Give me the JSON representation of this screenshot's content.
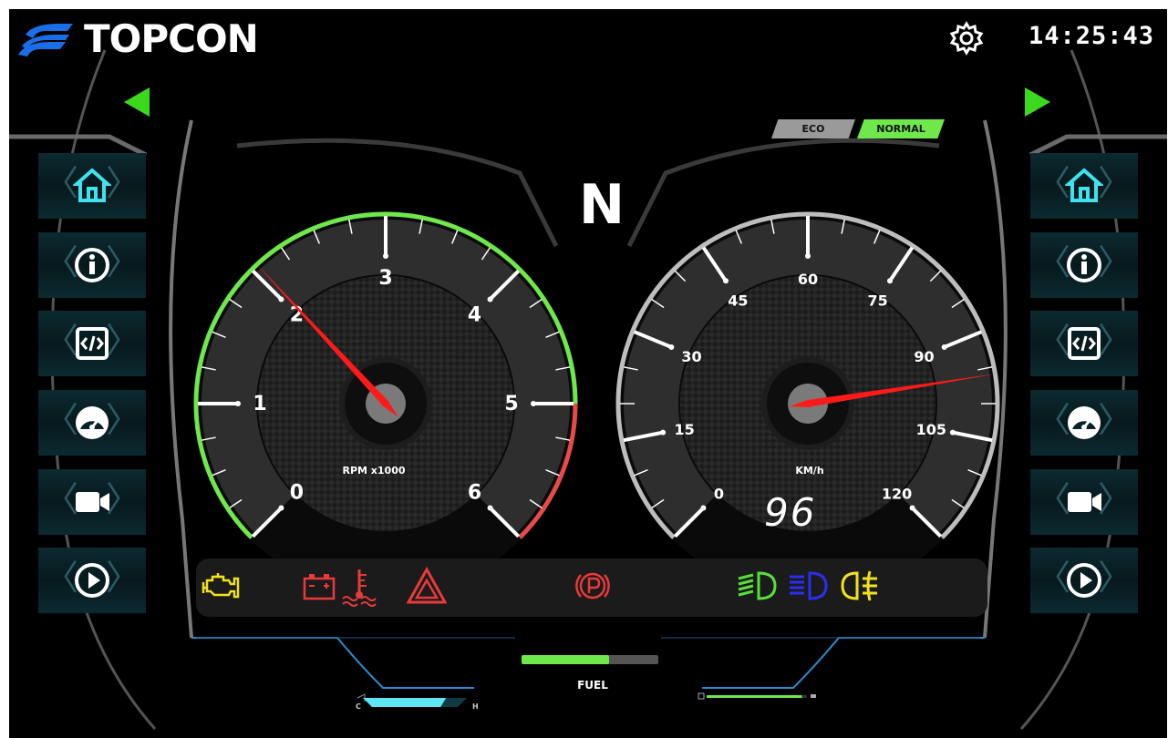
{
  "brand": {
    "name": "TOPCON"
  },
  "clock": {
    "time": "14:25:43"
  },
  "header": {
    "settings_icon": "gear-icon",
    "prev_icon": "triangle-left-icon",
    "next_icon": "triangle-right-icon"
  },
  "drive_mode": {
    "options": [
      "ECO",
      "NORMAL"
    ],
    "selected": "NORMAL"
  },
  "transmission": {
    "gear": "N"
  },
  "rpm_gauge": {
    "label": "RPM x1000",
    "ticks": [
      "0",
      "1",
      "2",
      "3",
      "4",
      "5",
      "6"
    ],
    "value": 2.05,
    "max": 6,
    "redline_from": 5,
    "colors": {
      "arc": "#6ee84a",
      "redline": "#e84a4a",
      "needle": "#ff1a1a"
    }
  },
  "speed_gauge": {
    "label": "KM/h",
    "ticks": [
      "0",
      "15",
      "30",
      "45",
      "60",
      "75",
      "90",
      "105",
      "120"
    ],
    "value": 96,
    "display": "96",
    "max": 120,
    "colors": {
      "arc": "#bdbdbd",
      "needle": "#ff1a1a"
    }
  },
  "side_nav": {
    "items": [
      {
        "name": "home",
        "icon": "home-icon"
      },
      {
        "name": "info",
        "icon": "info-icon"
      },
      {
        "name": "code",
        "icon": "code-icon"
      },
      {
        "name": "gauge",
        "icon": "gauge-icon"
      },
      {
        "name": "camera",
        "icon": "camera-icon"
      },
      {
        "name": "play",
        "icon": "play-icon"
      }
    ],
    "active": "home",
    "colors": {
      "active": "#3fe3f0",
      "inactive": "#ffffff"
    }
  },
  "warning_lights": [
    {
      "name": "check-engine",
      "icon": "engine-icon",
      "color": "#f2e21b"
    },
    {
      "name": "battery",
      "icon": "battery-icon",
      "color": "#e83a3a"
    },
    {
      "name": "coolant-temp",
      "icon": "coolant-icon",
      "color": "#e83a3a"
    },
    {
      "name": "hazard",
      "icon": "hazard-icon",
      "color": "#e83a3a"
    },
    {
      "name": "parking-brake",
      "icon": "parking-brake-icon",
      "color": "#e83a3a"
    },
    {
      "name": "low-beam",
      "icon": "low-beam-icon",
      "color": "#56e03a"
    },
    {
      "name": "high-beam",
      "icon": "high-beam-icon",
      "color": "#2a2ef2"
    },
    {
      "name": "fog-light",
      "icon": "fog-light-icon",
      "color": "#f2e21b"
    }
  ],
  "fuel": {
    "label": "FUEL",
    "level": 0.64,
    "color": "#6ee84a"
  },
  "temperature": {
    "low": "C",
    "high": "H",
    "level": 0.8,
    "color": "#5fe6f5"
  },
  "bottom_right_gauge": {
    "level": 0.95,
    "color": "#6ee84a"
  }
}
